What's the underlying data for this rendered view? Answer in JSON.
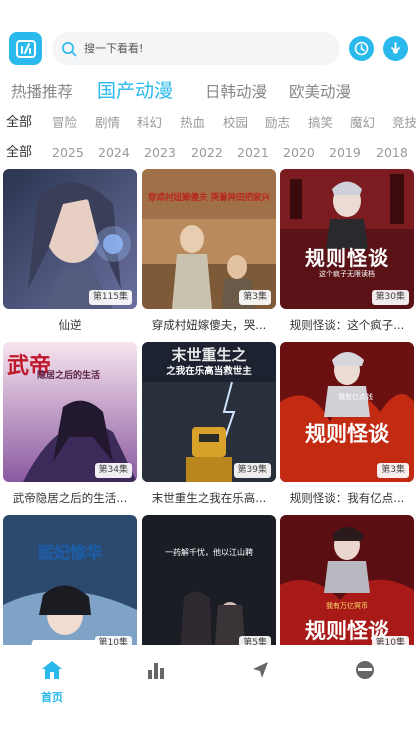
{
  "colors": {
    "accent": "#2ab9ec",
    "text": "#333333",
    "muted": "#999999"
  },
  "search": {
    "placeholder": "搜一下看看!"
  },
  "categories": [
    {
      "label": "热播推荐",
      "active": false
    },
    {
      "label": "国产动漫",
      "active": true
    },
    {
      "label": "日韩动漫",
      "active": false
    },
    {
      "label": "欧美动漫",
      "active": false
    }
  ],
  "genres": [
    "全部",
    "冒险",
    "剧情",
    "科幻",
    "热血",
    "校园",
    "励志",
    "搞笑",
    "魔幻",
    "竞技"
  ],
  "years": [
    "全部",
    "2025",
    "2024",
    "2023",
    "2022",
    "2021",
    "2020",
    "2019",
    "2018"
  ],
  "items": [
    {
      "title": "仙逆",
      "episode": "第115集"
    },
    {
      "title": "穿成村妞嫁傻夫，哭...",
      "episode": "第3集",
      "poster_text": "穿成村妞嫁傻夫 哭着种田把家兴"
    },
    {
      "title": "规则怪谈：这个疯子...",
      "episode": "第30集",
      "poster_text": "规则怪谈",
      "poster_sub": "这个疯子无限读档"
    },
    {
      "title": "武帝隐居之后的生活...",
      "episode": "第34集",
      "poster_text": "武帝",
      "poster_sub": "隐居之后的生活"
    },
    {
      "title": "末世重生之我在乐高...",
      "episode": "第39集",
      "poster_text": "末世重生之",
      "poster_sub": "之我在乐高当救世主"
    },
    {
      "title": "规则怪谈：我有亿点...",
      "episode": "第3集",
      "poster_text": "规则怪谈",
      "poster_sub": "我有亿点钱"
    },
    {
      "title": "",
      "episode": "第10集",
      "poster_text": "医妃惊华"
    },
    {
      "title": "",
      "episode": "第5集",
      "poster_text": "一药解千忧，他以江山聘"
    },
    {
      "title": "",
      "episode": "第10集",
      "poster_text": "规则怪谈",
      "poster_sub": "我有万亿冥币"
    }
  ],
  "bottom_nav": [
    {
      "label": "首页",
      "icon": "home-icon",
      "active": true
    },
    {
      "label": "",
      "icon": "ranking-icon",
      "active": false
    },
    {
      "label": "",
      "icon": "navigation-icon",
      "active": false
    },
    {
      "label": "",
      "icon": "profile-icon",
      "active": false
    }
  ]
}
